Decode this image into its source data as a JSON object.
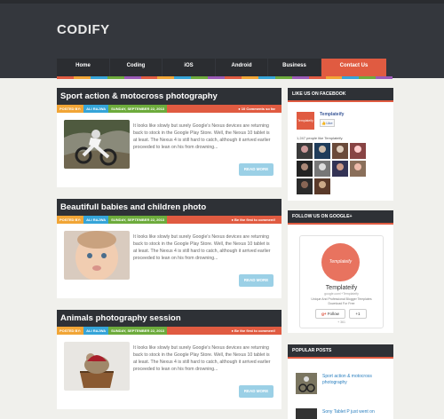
{
  "header": {
    "logo": "CODIFY"
  },
  "nav": [
    "Home",
    "Coding",
    "iOS",
    "Android",
    "Business",
    "Contact Us"
  ],
  "colors": {
    "accent": "#e05b41",
    "dark": "#2e3136",
    "postedby": "#f1a536",
    "author": "#35a4d8",
    "date": "#6dab3c"
  },
  "posts": [
    {
      "title": "Sport action & motocross photography",
      "posted_by": "POSTED BY:",
      "author": "ALI RAJWA",
      "date": "SUNDAY, SEPTEMBER 22, 2013",
      "comments": "10 Comments so far",
      "excerpt": "It looks like slowly but surely Google's Nexus devices are returning back to stock in the Google Play Store. Well, the Nexus 10 tablet is at least. The Nexus 4 is still hard to catch, although it arrived earlier proceeded to lean on his from drowning...",
      "read_more": "READ MORE"
    },
    {
      "title": "Beautifull babies and children photo",
      "posted_by": "POSTED BY:",
      "author": "ALI RAJWA",
      "date": "SUNDAY, SEPTEMBER 22, 2013",
      "comments": "Be the first to comment!",
      "excerpt": "It looks like slowly but surely Google's Nexus devices are returning back to stock in the Google Play Store. Well, the Nexus 10 tablet is at least. The Nexus 4 is still hard to catch, although it arrived earlier proceeded to lean on his from drowning...",
      "read_more": "READ MORE"
    },
    {
      "title": "Animals photography session",
      "posted_by": "POSTED BY:",
      "author": "ALI RAJWA",
      "date": "SUNDAY, SEPTEMBER 22, 2013",
      "comments": "Be the first to comment!",
      "excerpt": "It looks like slowly but surely Google's Nexus devices are returning back to stock in the Google Play Store. Well, the Nexus 10 tablet is at least. The Nexus 4 is still hard to catch, although it arrived earlier proceeded to lean on his from drowning...",
      "read_more": "READ MORE"
    }
  ],
  "sidebar": {
    "facebook": {
      "title": "LIKE US ON FACEBOOK",
      "page_name": "Templateify",
      "like": "Like",
      "people": "1,247 people like Templateify."
    },
    "google": {
      "title": "FOLLOW US ON GOOGLE+",
      "name": "Templateify",
      "url": "google.com/+Templateify",
      "tagline": "Unique And Professional Blogger Templates Download For Free",
      "follow": "Follow",
      "plus_one": "+1",
      "count": "+ 361"
    },
    "popular": {
      "title": "POPULAR POSTS",
      "items": [
        "Sport action & motocross photography",
        "Sony Tablet P just went on"
      ]
    }
  }
}
